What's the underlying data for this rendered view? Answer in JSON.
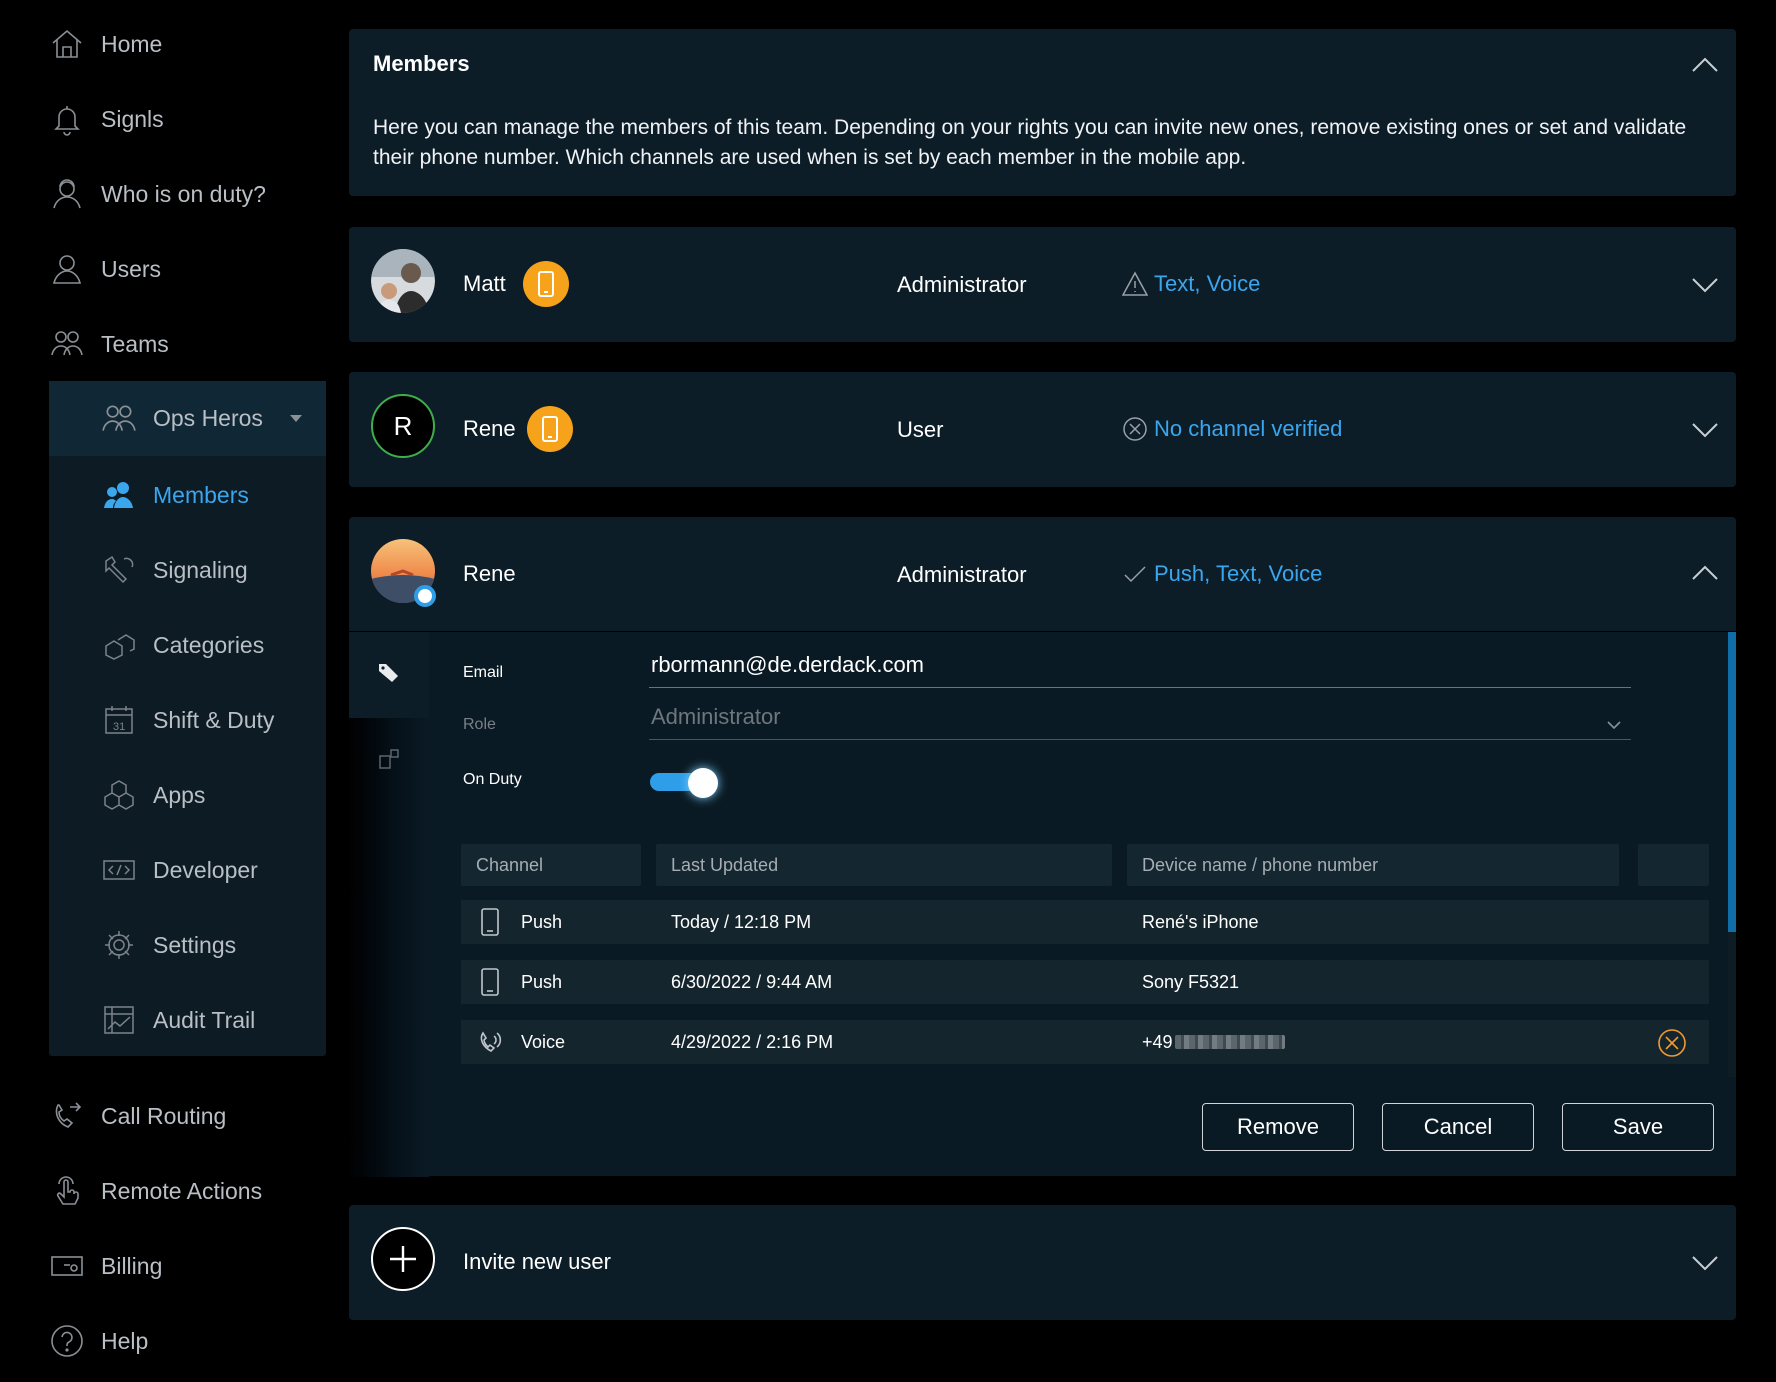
{
  "sidebar": {
    "items": [
      {
        "label": "Home",
        "icon": "home-icon"
      },
      {
        "label": "Signls",
        "icon": "bell-icon"
      },
      {
        "label": "Who is on duty?",
        "icon": "duty-icon"
      },
      {
        "label": "Users",
        "icon": "user-icon"
      },
      {
        "label": "Teams",
        "icon": "teams-icon"
      }
    ],
    "team": {
      "name": "Ops Heros",
      "sub_items": [
        {
          "label": "Members",
          "active": true
        },
        {
          "label": "Signaling"
        },
        {
          "label": "Categories"
        },
        {
          "label": "Shift & Duty"
        },
        {
          "label": "Apps"
        },
        {
          "label": "Developer"
        },
        {
          "label": "Settings"
        },
        {
          "label": "Audit Trail"
        }
      ]
    },
    "bottom_items": [
      {
        "label": "Call Routing"
      },
      {
        "label": "Remote Actions"
      },
      {
        "label": "Billing"
      },
      {
        "label": "Help"
      }
    ]
  },
  "members_panel": {
    "title": "Members",
    "description": "Here you can manage the members of this team. Depending on your rights you can invite new ones, remove existing ones or set and validate their phone number. Which channels are used when is set by each member in the mobile app."
  },
  "members": [
    {
      "name": "Matt",
      "role": "Administrator",
      "status": "Text, Voice",
      "status_icon": "warning-icon"
    },
    {
      "name": "Rene",
      "initial": "R",
      "role": "User",
      "status": "No channel verified",
      "status_icon": "x-circle-icon"
    },
    {
      "name": "Rene",
      "role": "Administrator",
      "status": "Push, Text, Voice",
      "status_icon": "check-icon"
    }
  ],
  "detail": {
    "email_label": "Email",
    "email_value": "rbormann@de.derdack.com",
    "role_label": "Role",
    "role_value": "Administrator",
    "on_duty_label": "On Duty",
    "on_duty": true,
    "table": {
      "headers": [
        "Channel",
        "Last Updated",
        "Device name / phone number"
      ],
      "rows": [
        {
          "channel": "Push",
          "updated": "Today / 12:18 PM",
          "device": "René's iPhone"
        },
        {
          "channel": "Push",
          "updated": "6/30/2022 / 9:44 AM",
          "device": "Sony F5321"
        },
        {
          "channel": "Voice",
          "updated": "4/29/2022 / 2:16 PM",
          "device": "+49"
        }
      ]
    },
    "buttons": {
      "remove": "Remove",
      "cancel": "Cancel",
      "save": "Save"
    }
  },
  "invite": {
    "label": "Invite new user"
  },
  "colors": {
    "accent": "#3aa6ee",
    "badge": "#f7a21b",
    "panel": "#0c1d28"
  }
}
